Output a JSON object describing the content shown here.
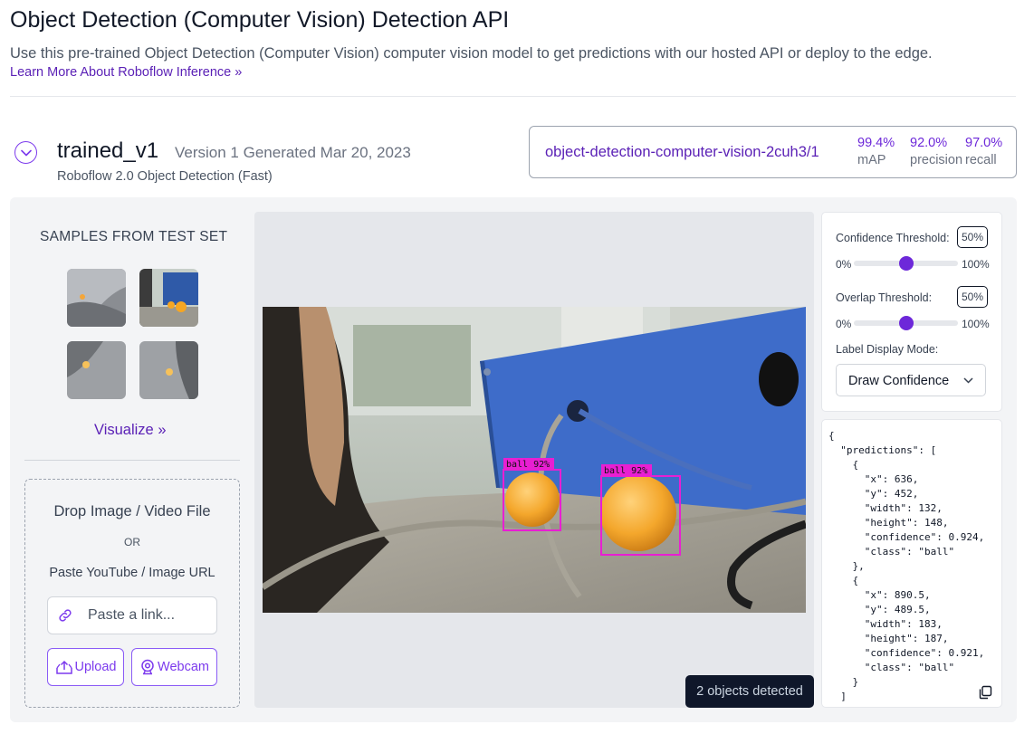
{
  "header": {
    "title": "Object Detection (Computer Vision) Detection API",
    "subtitle": "Use this pre-trained Object Detection (Computer Vision) computer vision model to get predictions with our hosted API or deploy to the edge.",
    "learn_more": "Learn More About Roboflow Inference »"
  },
  "version": {
    "name": "trained_v1",
    "meta": "Version 1 Generated Mar 20, 2023",
    "model_type": "Roboflow 2.0 Object Detection (Fast)"
  },
  "model": {
    "id": "object-detection-computer-vision-2cuh3/1",
    "metrics": [
      {
        "value": "99.4%",
        "label": "mAP"
      },
      {
        "value": "92.0%",
        "label": "precision"
      },
      {
        "value": "97.0%",
        "label": "recall"
      }
    ]
  },
  "samples": {
    "title": "SAMPLES FROM TEST SET",
    "visualize": "Visualize »"
  },
  "upload": {
    "drop_title": "Drop Image / Video File",
    "or": "OR",
    "paste_label": "Paste YouTube / Image URL",
    "link_placeholder": "Paste a link...",
    "upload_label": "Upload",
    "webcam_label": "Webcam"
  },
  "viewer": {
    "detections": [
      {
        "label": "ball 92%"
      },
      {
        "label": "ball 92%"
      }
    ],
    "status": "2 objects detected"
  },
  "settings": {
    "confidence_label": "Confidence Threshold:",
    "confidence_value": "50%",
    "confidence_level": 0.5,
    "overlap_label": "Overlap Threshold:",
    "overlap_value": "50%",
    "overlap_level": 0.5,
    "range_min": "0%",
    "range_max": "100%",
    "display_mode_label": "Label Display Mode:",
    "display_mode_value": "Draw Confidence"
  },
  "json_output": "{\n  \"predictions\": [\n    {\n      \"x\": 636,\n      \"y\": 452,\n      \"width\": 132,\n      \"height\": 148,\n      \"confidence\": 0.924,\n      \"class\": \"ball\"\n    },\n    {\n      \"x\": 890.5,\n      \"y\": 489.5,\n      \"width\": 183,\n      \"height\": 187,\n      \"confidence\": 0.921,\n      \"class\": \"ball\"\n    }\n  ]\n}"
}
